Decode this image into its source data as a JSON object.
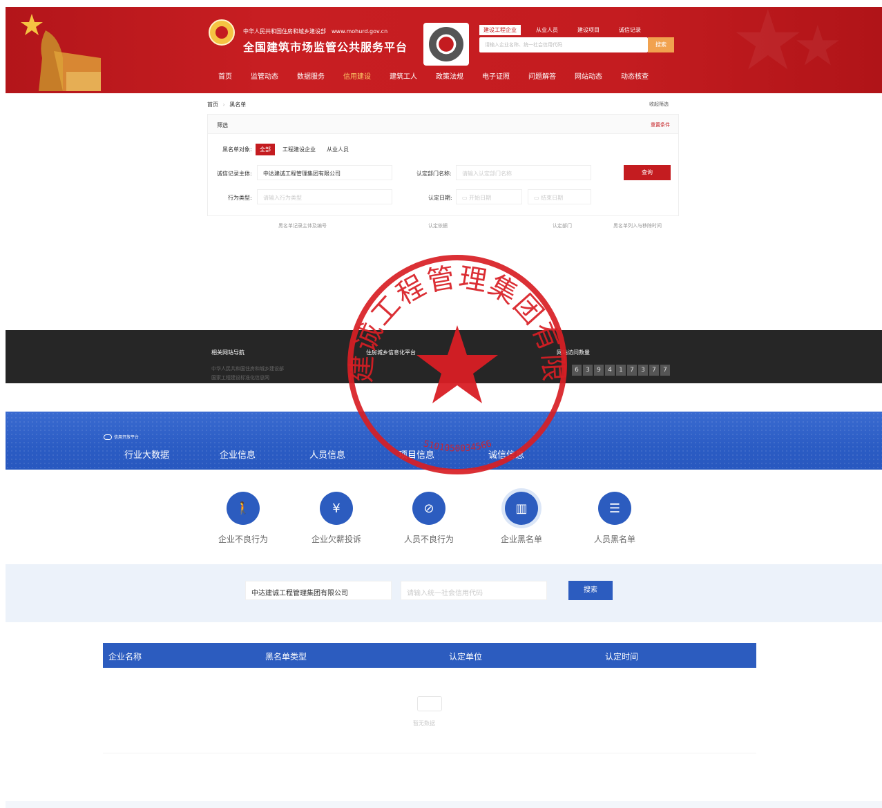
{
  "header": {
    "ministry": "中华人民共和国住房和城乡建设部",
    "url": "www.mohurd.gov.cn",
    "site_title": "全国建筑市场监管公共服务平台",
    "top_tabs": [
      "建设工程企业",
      "从业人员",
      "建设项目",
      "诚信记录"
    ],
    "search_placeholder": "请输入企业名称、统一社会信用代码",
    "search_button": "搜索",
    "nav": [
      "首页",
      "监管动态",
      "数据服务",
      "信用建设",
      "建筑工人",
      "政策法规",
      "电子证照",
      "问题解答",
      "网站动态",
      "动态核查"
    ]
  },
  "breadcrumb": {
    "home": "首页",
    "current": "黑名单"
  },
  "collapse_label": "收起筛选",
  "filter": {
    "title": "筛选",
    "reset": "重置条件",
    "object_label": "黑名单对象:",
    "object_options": [
      "全部",
      "工程建设企业",
      "从业人员"
    ],
    "subject_label": "诚信记录主体:",
    "subject_value": "中达建诚工程管理集团有限公司",
    "dept_label": "认定部门名称:",
    "dept_placeholder": "请输入认定部门名称",
    "query_button": "查询",
    "behavior_label": "行为类型:",
    "behavior_placeholder": "请输入行为类型",
    "date_label": "认定日期:",
    "date_start": "开始日期",
    "date_end": "结束日期",
    "columns": [
      "黑名单记录主体及编号",
      "认定依据",
      "认定部门",
      "黑名单列入与移除时间"
    ]
  },
  "footer_dark": {
    "col1_title": "相关网站导航",
    "col1_links": [
      "中华人民共和国住房和城乡建设部",
      "国家工程建设标准化信息网"
    ],
    "col2_title": "住房城乡信息化平台",
    "col3_title": "网站访问数量",
    "visitor_digits": [
      "6",
      "3",
      "9",
      "4",
      "1",
      "7",
      "3",
      "7",
      "7"
    ]
  },
  "credit_platform": {
    "logo_text": "信用开放平台",
    "nav": [
      "行业大数据",
      "企业信息",
      "人员信息",
      "项目信息",
      "诚信信息"
    ],
    "categories": [
      {
        "label": "企业不良行为",
        "icon": "walking-person-icon"
      },
      {
        "label": "企业欠薪投诉",
        "icon": "money-bag-icon"
      },
      {
        "label": "人员不良行为",
        "icon": "person-ban-icon"
      },
      {
        "label": "企业黑名单",
        "icon": "building-ban-icon"
      },
      {
        "label": "人员黑名单",
        "icon": "person-list-ban-icon"
      }
    ],
    "search_value": "中达建诚工程管理集团有限公司",
    "search_placeholder2": "请输入统一社会信用代码",
    "search_button": "搜索",
    "table_columns": [
      "企业名称",
      "黑名单类型",
      "认定单位",
      "认定时间"
    ],
    "empty_text": "暂无数据"
  },
  "seal": {
    "text": "中达建诚工程管理集团有限公司",
    "code": "5101050034566"
  },
  "colors": {
    "brand_red": "#c41c20",
    "credit_blue": "#2c5cbf",
    "seal_red": "#d81e24"
  }
}
